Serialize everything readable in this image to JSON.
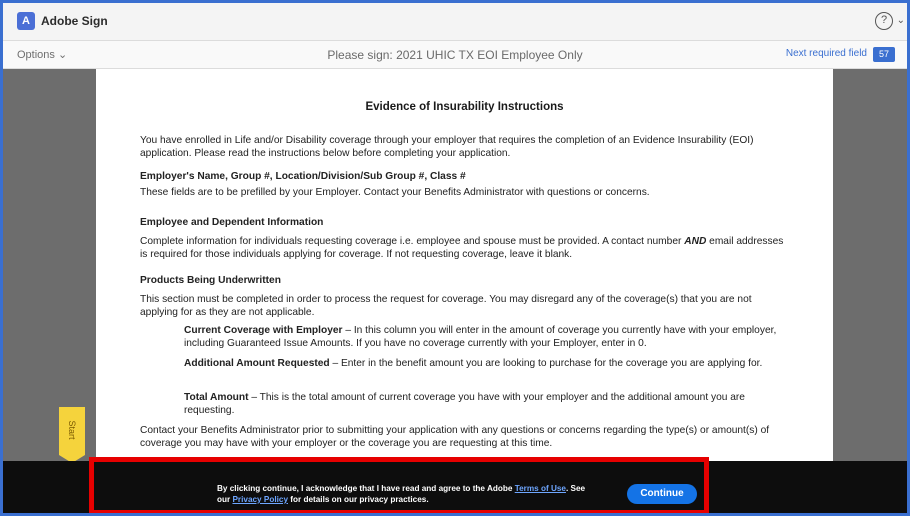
{
  "app": {
    "title": "Adobe Sign",
    "logo_glyph": "A"
  },
  "topbar": {
    "help_icon": "?",
    "help_caret": "⌄"
  },
  "subbar": {
    "options_label": "Options ⌄",
    "document_title": "Please sign: 2021 UHIC TX EOI Employee Only",
    "next_required_label": "Next required field",
    "required_count": "57"
  },
  "document": {
    "heading": "Evidence of Insurability Instructions",
    "intro": "You have enrolled in Life and/or Disability coverage through your employer that requires the completion of an Evidence Insurability (EOI) application. Please read the instructions below before completing your application.",
    "section1_title": "Employer's Name, Group #, Location/Division/Sub Group #, Class #",
    "section1_text": "These fields are to be prefilled by your Employer. Contact your Benefits Administrator with questions or concerns.",
    "section2_title": "Employee and Dependent Information",
    "section2_text_a": "Complete information for individuals requesting coverage i.e. employee and spouse must be provided. A contact number",
    "section2_text_b": "AND",
    "section2_text_c": "email addresses is required for those individuals applying for coverage. If not requesting coverage, leave it blank.",
    "section3_title": "Products Being Underwritten",
    "section3_text": "This section must be completed in order to process the request for coverage. You may disregard any of the coverage(s) that you are not applying for as they are not applicable.",
    "item1_title": "Current Coverage with Employer",
    "item1_text": " – In this column you will enter in the amount of coverage you currently have with your employer, including Guaranteed Issue Amounts. If you have no coverage currently with your Employer, enter in 0.",
    "item2_title": "Additional Amount Requested",
    "item2_text": " – Enter in the benefit amount you are looking to purchase for the coverage you are applying for.",
    "item3_title": "Total Amount",
    "item3_text": " – This is the total amount of current coverage you have with your employer and the additional amount you are requesting.",
    "closing": "Contact your Benefits Administrator prior to submitting your application with any questions or concerns regarding the type(s) or amount(s) of coverage you may have with your employer or the coverage you are requesting at this time."
  },
  "start_tab": {
    "label": "Start"
  },
  "consent": {
    "text_a": "By clicking continue, I acknowledge that I have read and agree to the Adobe ",
    "terms_link": "Terms of Use",
    "text_b": ". See our ",
    "privacy_link": "Privacy Policy",
    "text_c": " for details on our privacy practices.",
    "continue_label": "Continue"
  }
}
